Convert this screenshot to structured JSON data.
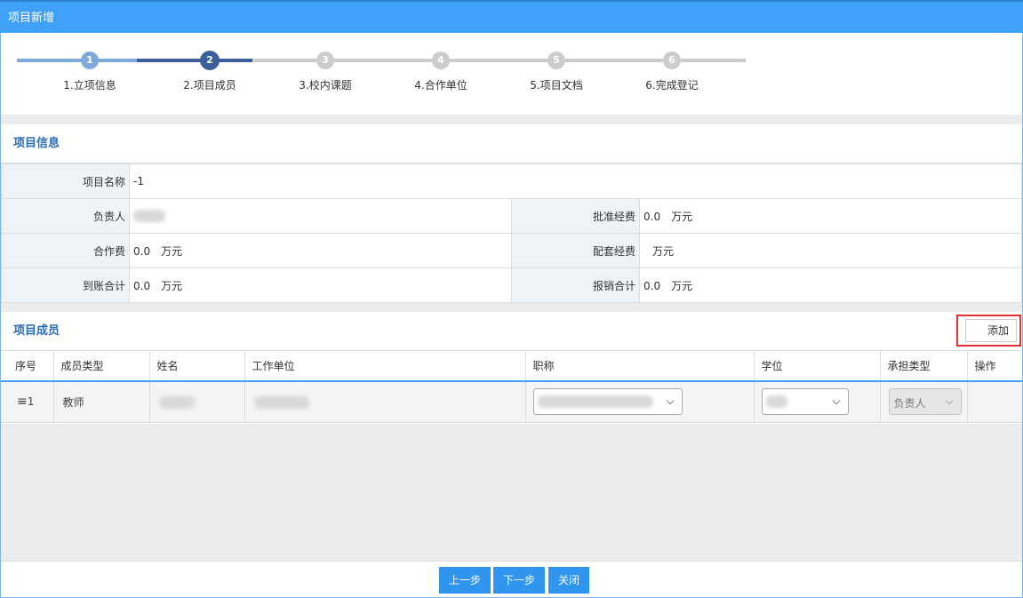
{
  "window": {
    "title": "项目新增"
  },
  "steps": [
    {
      "num": "1",
      "label": "1.立项信息"
    },
    {
      "num": "2",
      "label": "2.项目成员"
    },
    {
      "num": "3",
      "label": "3.校内课题"
    },
    {
      "num": "4",
      "label": "4.合作单位"
    },
    {
      "num": "5",
      "label": "5.项目文档"
    },
    {
      "num": "6",
      "label": "6.完成登记"
    }
  ],
  "project_info": {
    "title": "项目信息",
    "name_label": "项目名称",
    "name_value": "-1",
    "leader_label": "负责人",
    "approved_label": "批准经费",
    "approved_value": "0.0",
    "coop_label": "合作费",
    "coop_value": "0.0",
    "matching_label": "配套经费",
    "received_label": "到账合计",
    "received_value": "0.0",
    "reimbursed_label": "报销合计",
    "reimbursed_value": "0.0",
    "unit": "万元"
  },
  "members": {
    "title": "项目成员",
    "add_label": "添加",
    "columns": [
      "序号",
      "成员类型",
      "姓名",
      "工作单位",
      "职称",
      "学位",
      "承担类型",
      "操作"
    ],
    "rows": [
      {
        "index": "1",
        "type": "教师",
        "role": "负责人"
      }
    ]
  },
  "footer": {
    "prev": "上一步",
    "next": "下一步",
    "close": "关闭"
  },
  "colors": {
    "accent": "#3fa1f7",
    "step_done": "#7fa8dd",
    "step_active": "#3a5f9a",
    "step_todo": "#cccccc",
    "highlight": "#e03333"
  }
}
